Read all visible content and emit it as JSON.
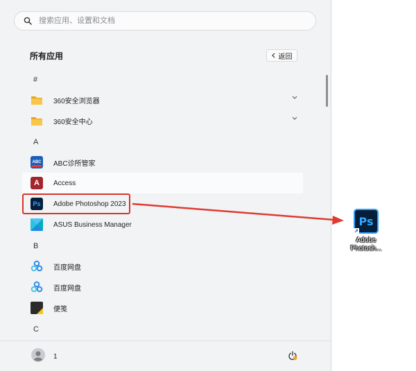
{
  "search": {
    "placeholder": "搜索应用、设置和文档"
  },
  "all_apps": {
    "title": "所有应用",
    "back_label": "返回"
  },
  "groups": [
    "#",
    "A",
    "B",
    "C"
  ],
  "apps": [
    {
      "label": "360安全浏览器",
      "icon": "folder-icon",
      "expandable": true
    },
    {
      "label": "360安全中心",
      "icon": "folder-icon",
      "expandable": true
    },
    {
      "label": "ABC诊所管家",
      "icon": "abc-clinic-icon",
      "expandable": false
    },
    {
      "label": "Access",
      "icon": "access-icon",
      "expandable": false
    },
    {
      "label": "Adobe Photoshop 2023",
      "icon": "photoshop-icon",
      "expandable": false,
      "highlighted": true
    },
    {
      "label": "ASUS Business Manager",
      "icon": "asus-business-manager-icon",
      "expandable": false
    },
    {
      "label": "百度网盘",
      "icon": "baidu-netdisk-icon",
      "expandable": false
    },
    {
      "label": "百度网盘",
      "icon": "baidu-netdisk-icon",
      "expandable": false
    },
    {
      "label": "便笺",
      "icon": "sticky-notes-icon",
      "expandable": false
    }
  ],
  "icon_text": {
    "abc": "ABC",
    "access": "A",
    "photoshop": "Ps"
  },
  "user": {
    "name": "1"
  },
  "desktop_shortcut": {
    "label": "Adobe Photosh...",
    "icon": "photoshop-icon",
    "icon_text": "Ps"
  },
  "colors": {
    "highlight": "#d9332b",
    "ps_blue": "#31a8ff",
    "ps_bg": "#061e3a"
  }
}
